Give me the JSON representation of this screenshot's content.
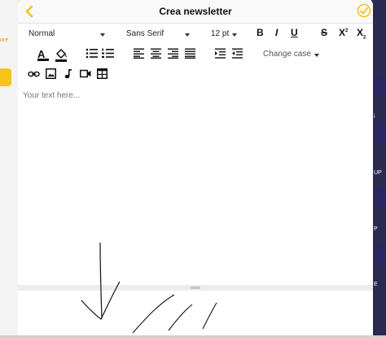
{
  "background": {
    "left_partial_text": "ore",
    "right_partial_labels": [
      "i",
      "UP",
      "P",
      "E"
    ]
  },
  "header": {
    "title": "Crea newsletter",
    "back_icon": "chevron-left-icon",
    "confirm_icon": "check-circle-icon"
  },
  "toolbar": {
    "paragraph_style": "Normal",
    "font_family": "Sans Serif",
    "font_size": "12 pt",
    "bold": "B",
    "italic": "I",
    "underline": "U",
    "strikethrough": "S",
    "superscript": "X",
    "superscript_mark": "2",
    "subscript": "X",
    "subscript_mark": "2",
    "text_color_letter": "A",
    "change_case": "Change case"
  },
  "editor": {
    "placeholder": "Your text here..."
  },
  "colors": {
    "accent": "#F5C518"
  }
}
